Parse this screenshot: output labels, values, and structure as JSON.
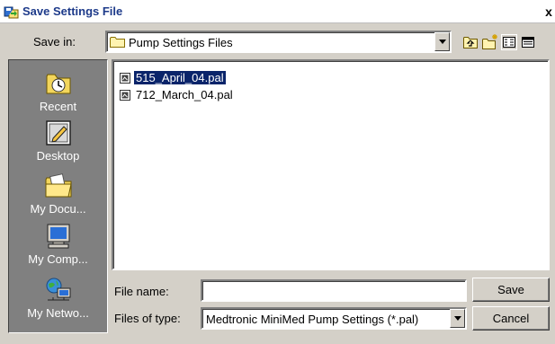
{
  "dialog": {
    "title": "Save Settings File",
    "close_label": "x"
  },
  "save_in": {
    "label": "Save in:",
    "value": "Pump Settings Files"
  },
  "toolbar": {
    "icons": [
      "up-one-level-icon",
      "new-folder-icon",
      "list-view-icon",
      "details-view-icon"
    ]
  },
  "places": [
    {
      "label": "Recent",
      "icon": "recent-icon"
    },
    {
      "label": "Desktop",
      "icon": "desktop-icon"
    },
    {
      "label": "My Docu...",
      "icon": "my-documents-icon"
    },
    {
      "label": "My Comp...",
      "icon": "my-computer-icon"
    },
    {
      "label": "My Netwo...",
      "icon": "my-network-icon"
    }
  ],
  "files": [
    {
      "name": "515_April_04.pal",
      "selected": true
    },
    {
      "name": "712_March_04.pal",
      "selected": false
    }
  ],
  "file_name": {
    "label": "File name:",
    "value": ""
  },
  "file_type": {
    "label": "Files of type:",
    "value": "Medtronic MiniMed Pump Settings (*.pal)"
  },
  "buttons": {
    "save": "Save",
    "cancel": "Cancel"
  },
  "colors": {
    "dialog_bg": "#d4d0c8",
    "places_bg": "#808080",
    "selection": "#0a246a"
  }
}
